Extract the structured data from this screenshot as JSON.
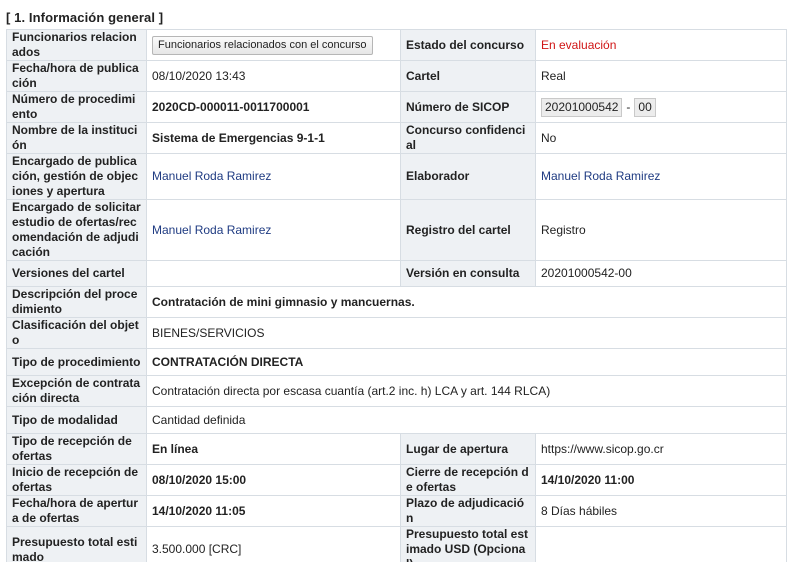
{
  "section": {
    "title": "[ 1. Información general ]"
  },
  "fields": {
    "funcionarios": {
      "label": "Funcionarios relacionados",
      "button": "Funcionarios relacionados con el concurso"
    },
    "estado": {
      "label": "Estado del concurso",
      "value": "En evaluación",
      "color": "#d01414"
    },
    "fecha_publicacion": {
      "label": "Fecha/hora de publicación",
      "value": "08/10/2020 13:43"
    },
    "cartel": {
      "label": "Cartel",
      "value": "Real"
    },
    "numero_procedimiento": {
      "label": "Número de procedimiento",
      "value": "2020CD-000011-0011700001"
    },
    "numero_sicop": {
      "label": "Número de SICOP",
      "part1": "20201000542",
      "separator": "-",
      "part2": "00"
    },
    "institucion": {
      "label": "Nombre de la institución",
      "value": "Sistema de Emergencias 9-1-1"
    },
    "confidencial": {
      "label": "Concurso confidencial",
      "value": "No"
    },
    "encargado_publicacion": {
      "label": "Encargado de publicación, gestión de objeciones y apertura",
      "value": "Manuel Roda Ramirez"
    },
    "elaborador": {
      "label": "Elaborador",
      "value": "Manuel Roda Ramirez"
    },
    "encargado_solicitar": {
      "label": "Encargado de solicitar estudio de ofertas/recomendación de adjudicación",
      "value": "Manuel Roda Ramirez"
    },
    "registro_cartel": {
      "label": "Registro del cartel",
      "value": "Registro"
    },
    "versiones": {
      "label": "Versiones del cartel",
      "value": ""
    },
    "version_consulta": {
      "label": "Versión en consulta",
      "value": "20201000542-00"
    },
    "descripcion": {
      "label": "Descripción del procedimiento",
      "value": "Contratación de mini gimnasio y mancuernas."
    },
    "clasificacion": {
      "label": "Clasificación del objeto",
      "value": "BIENES/SERVICIOS"
    },
    "tipo_procedimiento": {
      "label": "Tipo de procedimiento",
      "value": "CONTRATACIÓN DIRECTA"
    },
    "excepcion": {
      "label": "Excepción de contratación directa",
      "value": "Contratación directa por escasa cuantía (art.2 inc. h) LCA y art. 144 RLCA)"
    },
    "modalidad": {
      "label": "Tipo de modalidad",
      "value": "Cantidad definida"
    },
    "recepcion": {
      "label": "Tipo de recepción de ofertas",
      "value": "En línea"
    },
    "lugar_apertura": {
      "label": "Lugar de apertura",
      "value": "https://www.sicop.go.cr"
    },
    "inicio_recepcion": {
      "label": "Inicio de recepción de ofertas",
      "value": "08/10/2020 15:00"
    },
    "cierre_recepcion": {
      "label": "Cierre de recepción de ofertas",
      "value": "14/10/2020 11:00"
    },
    "fecha_apertura": {
      "label": "Fecha/hora de apertura de ofertas",
      "value": "14/10/2020 11:05"
    },
    "plazo_adjudicacion": {
      "label": "Plazo de adjudicación",
      "value": "8 Días hábiles"
    },
    "presupuesto": {
      "label": "Presupuesto total estimado",
      "value": "3.500.000 [CRC]"
    },
    "presupuesto_usd": {
      "label": "Presupuesto total estimado USD (Opcional)",
      "value": ""
    }
  }
}
